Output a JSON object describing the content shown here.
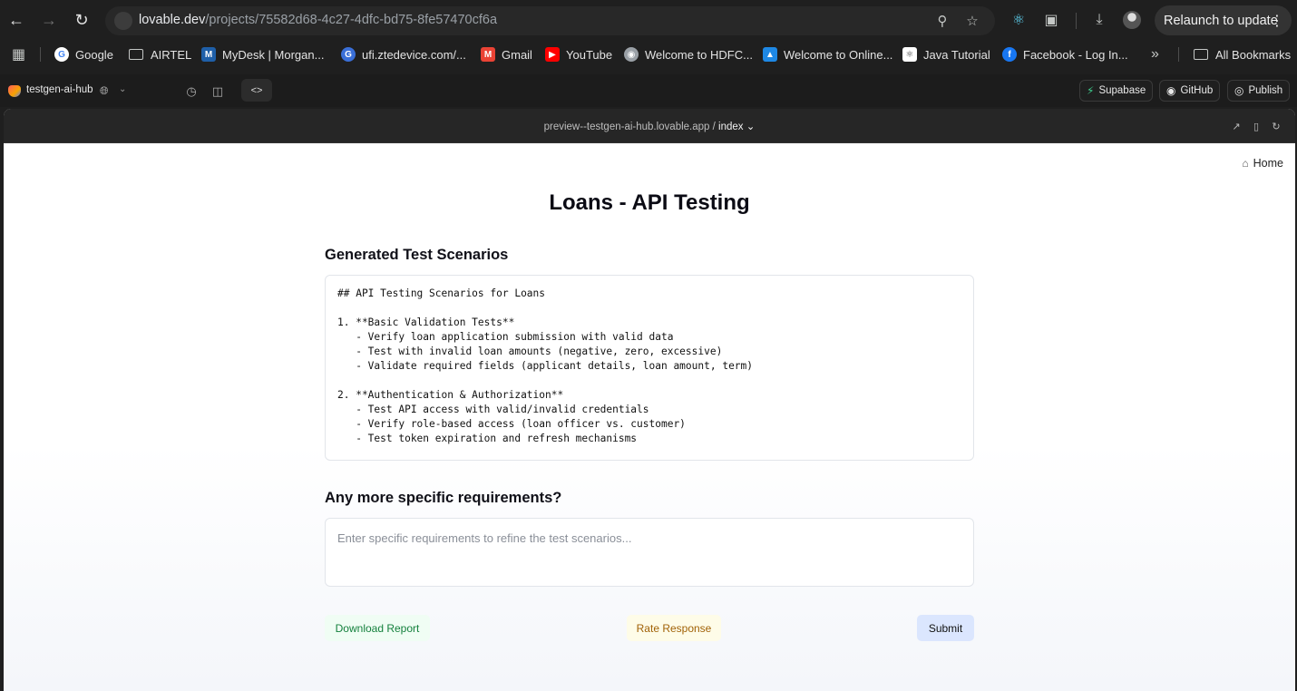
{
  "browser": {
    "url_host": "lovable.dev",
    "url_path": "/projects/75582d68-4c27-4dfc-bd75-8fe57470cf6a",
    "relaunch_label": "Relaunch to update",
    "bookmarks": [
      {
        "label": "Google",
        "icon": "google-icon",
        "color": "#4285f4"
      },
      {
        "label": "AIRTEL",
        "icon": "folder-icon",
        "color": "#c4c7c5"
      },
      {
        "label": "MyDesk | Morgan...",
        "icon": "mydesk-icon",
        "color": "#1f5fa8"
      },
      {
        "label": "ufi.ztedevice.com/...",
        "icon": "zte-icon",
        "color": "#3a6fd8"
      },
      {
        "label": "Gmail",
        "icon": "gmail-icon",
        "color": "#ea4335"
      },
      {
        "label": "YouTube",
        "icon": "youtube-icon",
        "color": "#ff0000"
      },
      {
        "label": "Welcome to HDFC...",
        "icon": "globe-icon",
        "color": "#9aa0a6"
      },
      {
        "label": "Welcome to Online...",
        "icon": "online-icon",
        "color": "#1e88e5"
      },
      {
        "label": "Java Tutorial",
        "icon": "java-icon",
        "color": "#e0e0e0"
      },
      {
        "label": "Facebook - Log In...",
        "icon": "facebook-icon",
        "color": "#1877f2"
      }
    ],
    "all_bookmarks_label": "All Bookmarks"
  },
  "lovable": {
    "project_name": "testgen-ai-hub",
    "supabase_label": "Supabase",
    "github_label": "GitHub",
    "publish_label": "Publish",
    "preview_host": "preview--testgen-ai-hub.lovable.app /",
    "preview_page": "index"
  },
  "page": {
    "home_label": "Home",
    "title": "Loans - API Testing",
    "scenarios_heading": "Generated Test Scenarios",
    "scenarios_text": "## API Testing Scenarios for Loans\n\n1. **Basic Validation Tests**\n   - Verify loan application submission with valid data\n   - Test with invalid loan amounts (negative, zero, excessive)\n   - Validate required fields (applicant details, loan amount, term)\n\n2. **Authentication & Authorization**\n   - Test API access with valid/invalid credentials\n   - Verify role-based access (loan officer vs. customer)\n   - Test token expiration and refresh mechanisms",
    "requirements_heading": "Any more specific requirements?",
    "requirements_placeholder": "Enter specific requirements to refine the test scenarios...",
    "requirements_value": "",
    "download_label": "Download Report",
    "rate_label": "Rate Response",
    "submit_label": "Submit"
  },
  "colors": {
    "download_bg": "#f0fdf4",
    "download_text": "#15803d",
    "rate_bg": "#fefce8",
    "rate_text": "#a16207",
    "submit_bg": "#dbe6fe"
  }
}
